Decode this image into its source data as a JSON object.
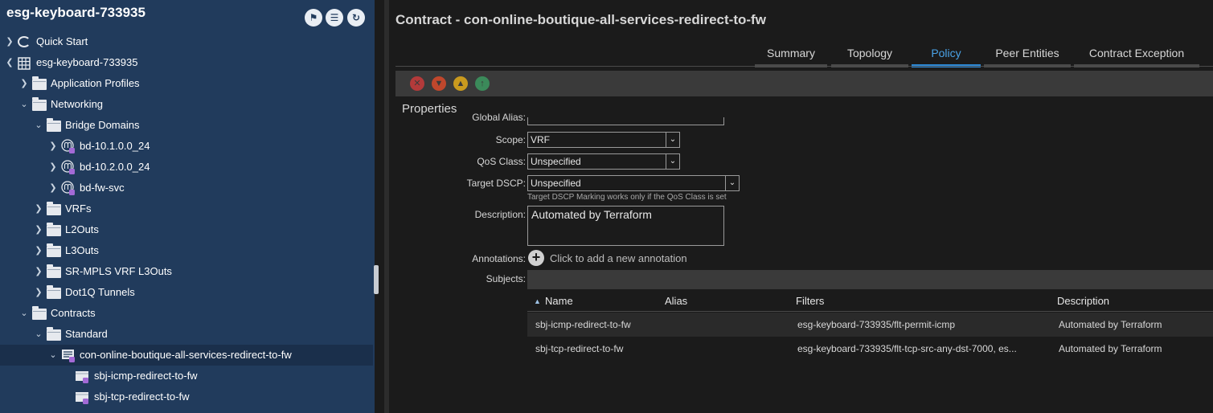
{
  "sidebar": {
    "title": "esg-keyboard-733935",
    "header_buttons": [
      "flag-icon",
      "list-icon",
      "refresh-icon"
    ],
    "tree": [
      {
        "label": "Quick Start",
        "icon": "quick-start-icon",
        "expanded": false
      },
      {
        "label": "esg-keyboard-733935",
        "icon": "tenant-grid-icon",
        "expanded": true
      },
      {
        "label": "Application Profiles",
        "icon": "folder-icon",
        "expanded": false
      },
      {
        "label": "Networking",
        "icon": "folder-icon",
        "expanded": true
      },
      {
        "label": "Bridge Domains",
        "icon": "folder-icon",
        "expanded": true
      },
      {
        "label": "bd-10.1.0.0_24",
        "icon": "bridge-domain-icon",
        "expanded": false
      },
      {
        "label": "bd-10.2.0.0_24",
        "icon": "bridge-domain-icon",
        "expanded": false
      },
      {
        "label": "bd-fw-svc",
        "icon": "bridge-domain-icon",
        "expanded": false
      },
      {
        "label": "VRFs",
        "icon": "folder-icon",
        "expanded": false
      },
      {
        "label": "L2Outs",
        "icon": "folder-icon",
        "expanded": false
      },
      {
        "label": "L3Outs",
        "icon": "folder-icon",
        "expanded": false
      },
      {
        "label": "SR-MPLS VRF L3Outs",
        "icon": "folder-icon",
        "expanded": false
      },
      {
        "label": "Dot1Q Tunnels",
        "icon": "folder-icon",
        "expanded": false
      },
      {
        "label": "Contracts",
        "icon": "folder-icon",
        "expanded": true
      },
      {
        "label": "Standard",
        "icon": "folder-icon",
        "expanded": true
      },
      {
        "label": "con-online-boutique-all-services-redirect-to-fw",
        "icon": "contract-icon",
        "expanded": true,
        "selected": true
      },
      {
        "label": "sbj-icmp-redirect-to-fw",
        "icon": "subject-icon"
      },
      {
        "label": "sbj-tcp-redirect-to-fw",
        "icon": "subject-icon"
      }
    ]
  },
  "main": {
    "title": "Contract - con-online-boutique-all-services-redirect-to-fw",
    "tabs": [
      {
        "label": "Summary",
        "active": false
      },
      {
        "label": "Topology",
        "active": false
      },
      {
        "label": "Policy",
        "active": true
      },
      {
        "label": "Peer Entities",
        "active": false
      },
      {
        "label": "Contract Exception",
        "active": false
      }
    ],
    "toolbar_icons": [
      "delete-fault-icon",
      "critical-fault-icon",
      "warning-fault-icon",
      "info-fault-icon"
    ],
    "properties": {
      "heading": "Properties",
      "global_alias_label": "Global Alias:",
      "scope_label": "Scope:",
      "scope_value": "VRF",
      "qos_label": "QoS Class:",
      "qos_value": "Unspecified",
      "dscp_label": "Target DSCP:",
      "dscp_value": "Unspecified",
      "dscp_hint": "Target DSCP Marking works only if the QoS Class is set",
      "description_label": "Description:",
      "description_value": "Automated by Terraform",
      "annotations_label": "Annotations:",
      "annotations_add": "Click to add a new annotation",
      "subjects_label": "Subjects:"
    },
    "subjects_table": {
      "columns": [
        "Name",
        "Alias",
        "Filters",
        "Description"
      ],
      "rows": [
        {
          "name": "sbj-icmp-redirect-to-fw",
          "alias": "",
          "filters": "esg-keyboard-733935/flt-permit-icmp",
          "description": "Automated by Terraform"
        },
        {
          "name": "sbj-tcp-redirect-to-fw",
          "alias": "",
          "filters": "esg-keyboard-733935/flt-tcp-src-any-dst-7000, es...",
          "description": "Automated by Terraform"
        }
      ]
    }
  },
  "colors": {
    "sidebar_bg": "#213b5c",
    "accent_tab": "#2c8ad9",
    "content_bg": "#1b1b1b"
  }
}
